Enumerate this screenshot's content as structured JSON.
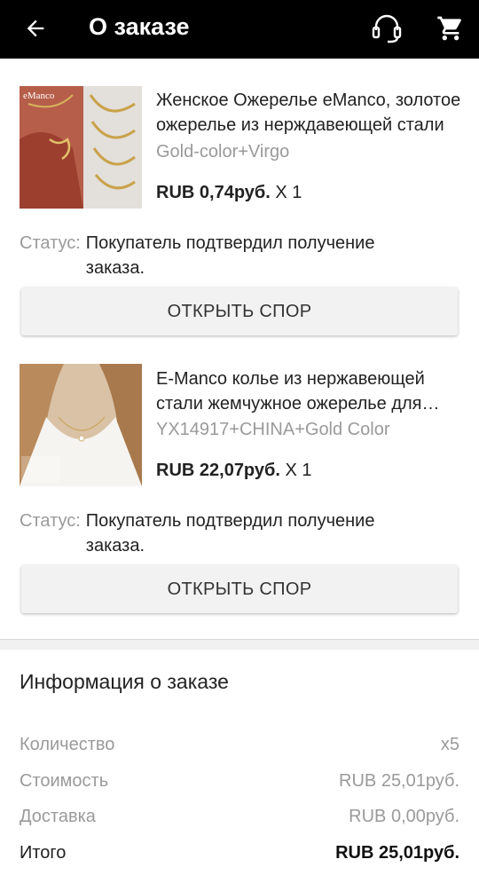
{
  "header": {
    "title": "О заказе",
    "back_icon": "arrow-left-icon",
    "support_icon": "headset-icon",
    "cart_icon": "cart-icon"
  },
  "items": [
    {
      "name": "Женское Ожерелье eManco, золотое ожерелье из нерждавеющей стали",
      "variant": "Gold-color+Virgo",
      "price": "RUB 0,74руб.",
      "qty": "X 1",
      "status_label": "Статус:",
      "status_text": "Покупатель подтвердил получение заказа.",
      "button_label": "ОТКРЫТЬ СПОР",
      "thumb_brand": "eManco"
    },
    {
      "name": "E-Manco колье из нержавеющей стали жемчужное ожерелье для женщин",
      "variant": "YX14917+CHINA+Gold Color",
      "price": "RUB 22,07руб.",
      "qty": "X 1",
      "status_label": "Статус:",
      "status_text": "Покупатель подтвердил получение заказа.",
      "button_label": "ОТКРЫТЬ СПОР"
    }
  ],
  "info": {
    "title": "Информация о заказе",
    "rows": [
      {
        "label": "Количество",
        "value": "x5"
      },
      {
        "label": "Стоимость",
        "value": "RUB 25,01руб."
      },
      {
        "label": "Доставка",
        "value": "RUB 0,00руб."
      },
      {
        "label": "Итого",
        "value": "RUB 25,01руб."
      }
    ]
  },
  "colors": {
    "header_bg": "#000000",
    "muted_text": "#9a9a9a",
    "button_bg": "#f2f2f2"
  }
}
